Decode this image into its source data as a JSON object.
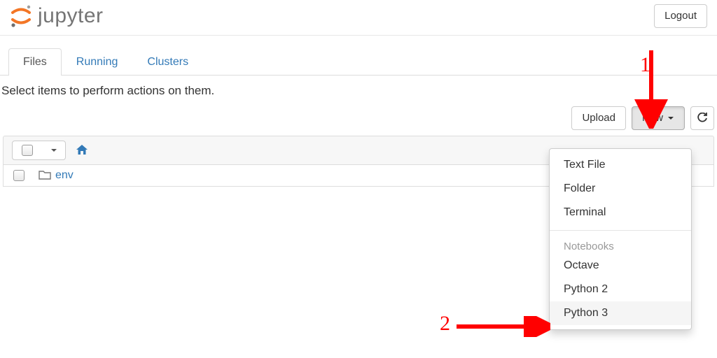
{
  "header": {
    "logo_text": "jupyter",
    "logout_label": "Logout"
  },
  "tabs": [
    {
      "label": "Files",
      "active": true
    },
    {
      "label": "Running",
      "active": false
    },
    {
      "label": "Clusters",
      "active": false
    }
  ],
  "instruction": "Select items to perform actions on them.",
  "toolbar": {
    "upload_label": "Upload",
    "new_label": "New",
    "refresh_title": "Refresh"
  },
  "breadcrumb": {
    "home_title": "Home"
  },
  "files": [
    {
      "name": "env",
      "type": "folder"
    }
  ],
  "new_menu": {
    "plain_items": [
      "Text File",
      "Folder",
      "Terminal"
    ],
    "section_header": "Notebooks",
    "notebook_items": [
      "Octave",
      "Python 2",
      "Python 3"
    ],
    "highlighted": "Python 3"
  },
  "annotations": {
    "num1": "1",
    "num2": "2"
  }
}
